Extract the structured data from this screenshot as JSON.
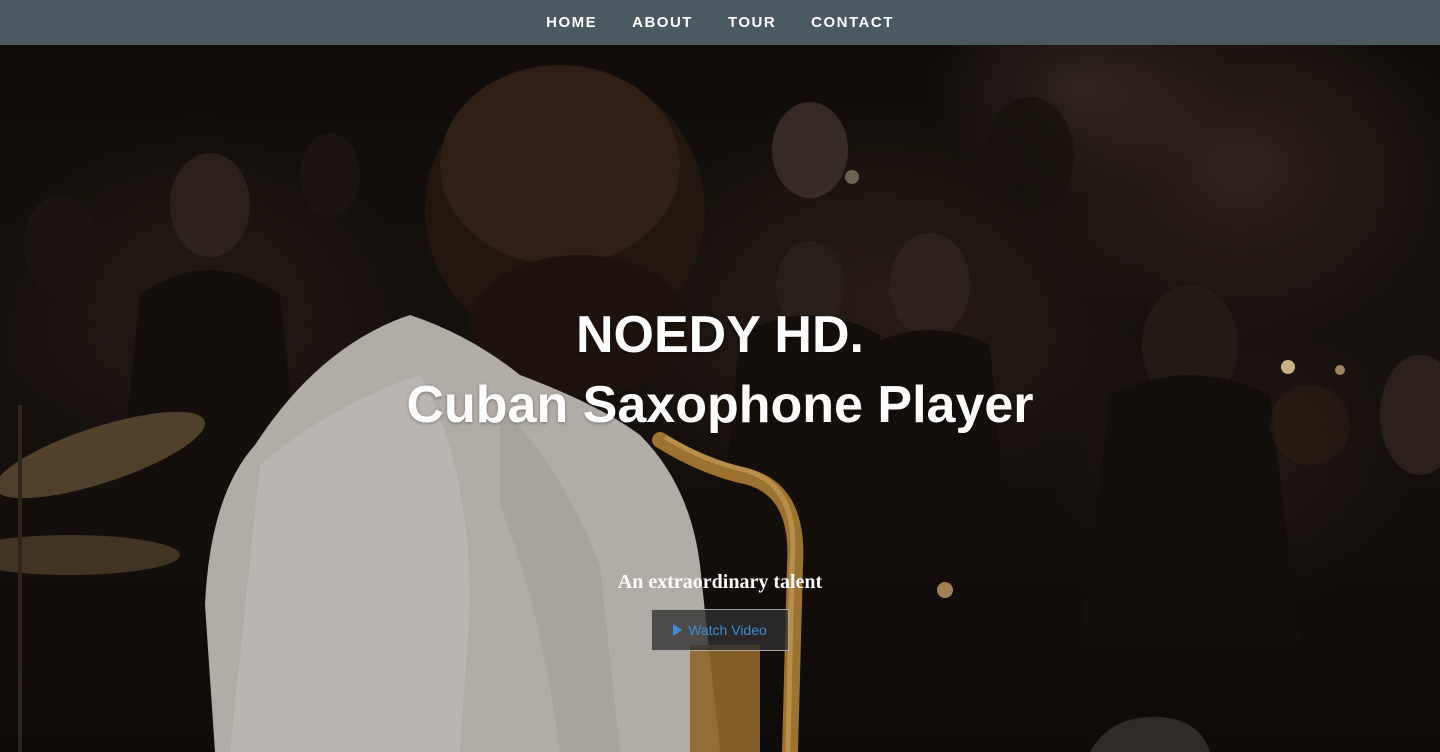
{
  "nav": {
    "items": [
      {
        "label": "HOME"
      },
      {
        "label": "ABOUT"
      },
      {
        "label": "TOUR"
      },
      {
        "label": "CONTACT"
      }
    ]
  },
  "hero": {
    "title_line1": "NOEDY HD.",
    "title_line2": "Cuban Saxophone Player",
    "tagline": "An extraordinary talent",
    "button": {
      "icon": "play-icon",
      "label": "Watch Video"
    }
  },
  "colors": {
    "nav_background": "#4b5961",
    "nav_text": "#ffffff",
    "hero_text": "#ffffff",
    "button_text": "#3c8fd6",
    "button_border": "#a8a8a8"
  }
}
